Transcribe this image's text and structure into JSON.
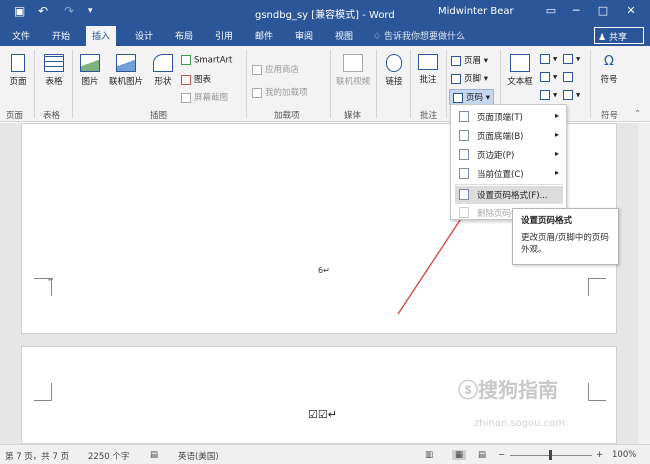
{
  "window": {
    "title": "gsndbg_sy [兼容模式] - Word",
    "user": "Midwinter Bear",
    "controls": [
      "restore-icon",
      "minimize-icon",
      "maximize-icon",
      "close-icon"
    ]
  },
  "quick_access": {
    "save": "save-icon",
    "undo": "undo-icon",
    "redo": "redo-icon",
    "customize": "▾"
  },
  "tabs": [
    "文件",
    "开始",
    "插入",
    "设计",
    "布局",
    "引用",
    "邮件",
    "审阅",
    "视图"
  ],
  "active_tab": "插入",
  "tell_me": "告诉我你想要做什么",
  "share": "共享",
  "ribbon": {
    "page": "页面",
    "table": "表格",
    "picture": "图片",
    "online_picture": "联机图片",
    "shapes": "形状",
    "smartart": "SmartArt",
    "chart": "图表",
    "screenshot": "屏幕截图",
    "store": "应用商店",
    "my_addins": "我的加载项",
    "online_video": "联机视频",
    "link": "链接",
    "comment": "批注",
    "header": "页眉",
    "footer": "页脚",
    "page_number": "页码",
    "textbox": "文本框",
    "symbol": "符号"
  },
  "groups": {
    "page": "页面",
    "table": "表格",
    "illustrations": "插图",
    "addins": "加载项",
    "media": "媒体",
    "comments": "批注",
    "symbols": "符号"
  },
  "menu": {
    "items": [
      {
        "label": "页面顶端(T)"
      },
      {
        "label": "页面底端(B)"
      },
      {
        "label": "页边距(P)"
      },
      {
        "label": "当前位置(C)"
      },
      {
        "label": "设置页码格式(F)..."
      },
      {
        "label": "删除页码"
      }
    ]
  },
  "tooltip": {
    "title": "设置页码格式",
    "body": "更改页眉/页脚中的页码外观。"
  },
  "document": {
    "page_number_text": "6↵",
    "checkboxes": "☑☑↵"
  },
  "status": {
    "pages": "第 7 页，共 7 页",
    "words": "2250 个字",
    "language": "英语(美国)",
    "zoom": "100%"
  },
  "watermark": {
    "text": "搜狗指南",
    "url": "zhinan.sogou.com"
  },
  "colors": {
    "accent": "#2b579a",
    "annotation_arrow": "#d9403b"
  }
}
